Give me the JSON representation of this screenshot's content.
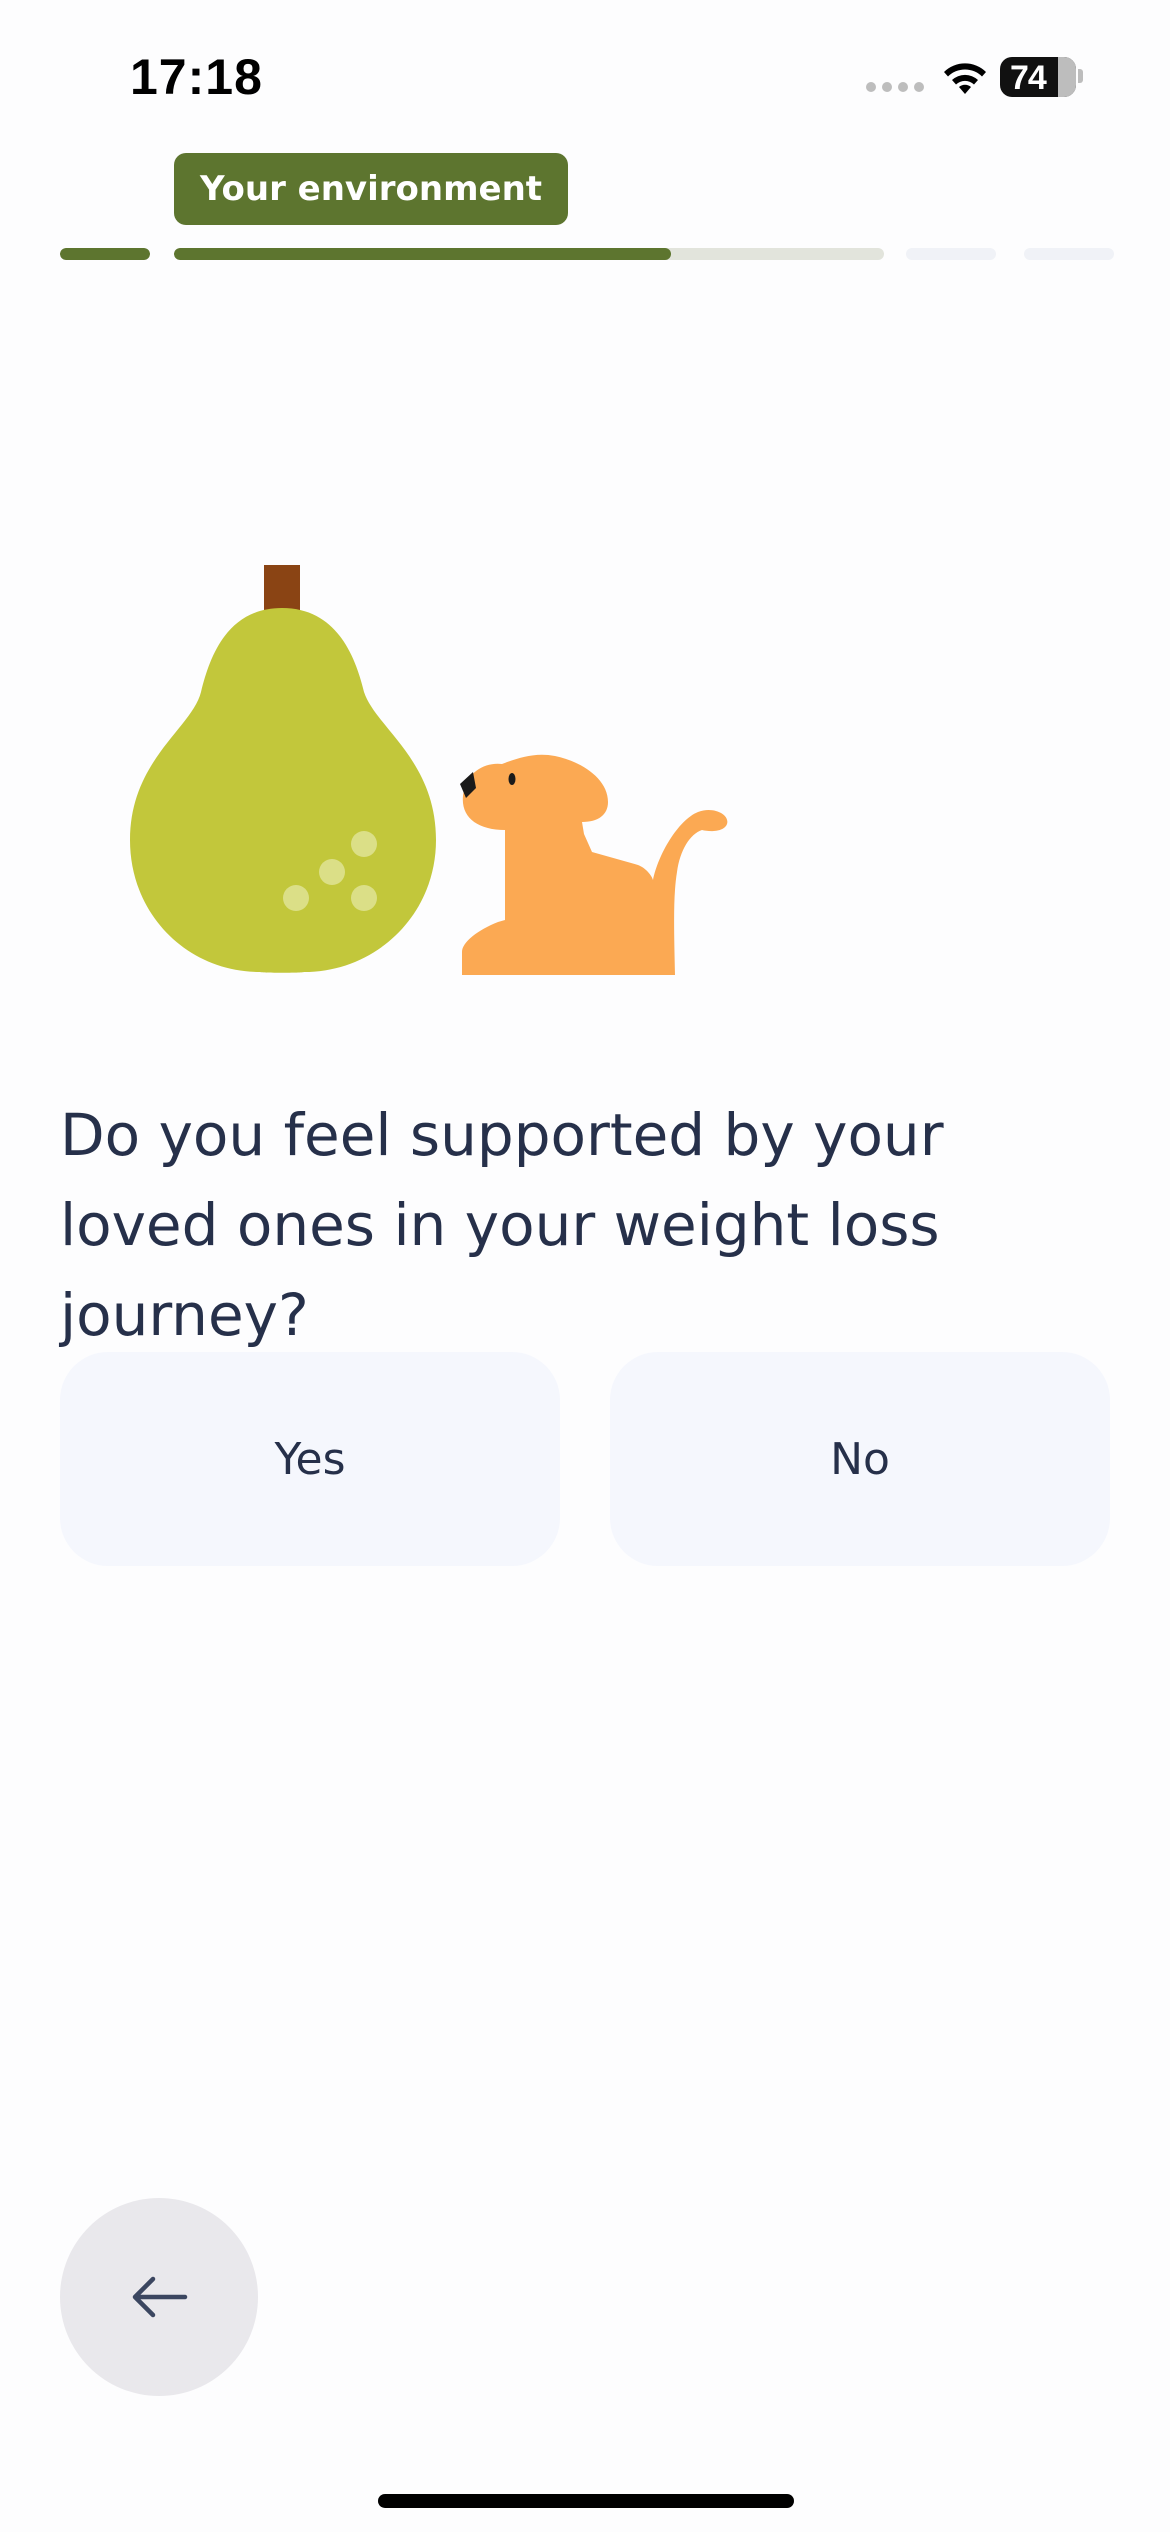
{
  "status_bar": {
    "time": "17:18",
    "battery_level": "74",
    "icons": [
      "cellular-signal-icon",
      "wifi-icon",
      "battery-icon"
    ]
  },
  "header": {
    "section_label": "Your environment",
    "progress": {
      "segments": [
        {
          "fill_fraction": 1.0
        },
        {
          "fill_fraction": 0.7
        },
        {
          "fill_fraction": 0.0
        },
        {
          "fill_fraction": 0.0
        }
      ]
    }
  },
  "illustration": {
    "icons": [
      "pear-icon",
      "cat-icon"
    ],
    "colors": {
      "pear": "#C2C73B",
      "stem": "#8A4414",
      "cat": "#FBA953"
    }
  },
  "question": {
    "text": "Do you feel supported by your loved ones in your weight loss journey?"
  },
  "answers": [
    {
      "label": "Yes"
    },
    {
      "label": "No"
    }
  ],
  "navigation": {
    "back_icon": "arrow-left-icon"
  },
  "colors": {
    "accent": "#5D752F",
    "text": "#26304A",
    "button_bg": "#F5F7FD",
    "back_button_bg": "#E9E8EC"
  }
}
